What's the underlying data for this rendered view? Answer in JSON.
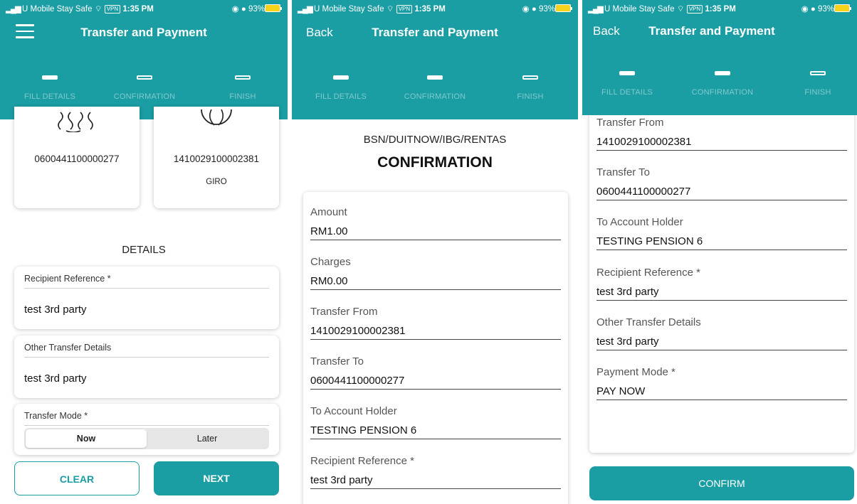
{
  "status": {
    "carrier": "U Mobile Stay Safe",
    "vpn": "VPN",
    "time": "1:35 PM",
    "battery": "93%"
  },
  "header": {
    "title": "Transfer and Payment",
    "back_label": "Back"
  },
  "steps": [
    "FILL DETAILS",
    "CONFIRMATION",
    "FINISH"
  ],
  "panel1": {
    "accounts": [
      {
        "number": "0600441100000277",
        "sub": ""
      },
      {
        "number": "1410029100002381",
        "sub": "GIRO"
      }
    ],
    "section_title": "DETAILS",
    "fields": [
      {
        "label": "Recipient Reference *",
        "value": "test 3rd party"
      },
      {
        "label": "Other Transfer Details",
        "value": "test 3rd party"
      }
    ],
    "transfer_mode": {
      "label": "Transfer Mode *",
      "options": [
        "Now",
        "Later"
      ],
      "selected": "Now"
    },
    "clear_label": "CLEAR",
    "next_label": "NEXT"
  },
  "panel2": {
    "route": "BSN/DUITNOW/IBG/RENTAS",
    "title": "CONFIRMATION",
    "rows": [
      {
        "label": "Amount",
        "value": "RM1.00"
      },
      {
        "label": "Charges",
        "value": "RM0.00"
      },
      {
        "label": "Transfer From",
        "value": "1410029100002381"
      },
      {
        "label": "Transfer To",
        "value": "0600441100000277"
      },
      {
        "label": "To Account Holder",
        "value": "TESTING PENSION 6"
      },
      {
        "label": "Recipient Reference *",
        "value": "test 3rd party"
      }
    ]
  },
  "panel3": {
    "rows": [
      {
        "label": "Transfer From",
        "value": "1410029100002381"
      },
      {
        "label": "Transfer To",
        "value": "0600441100000277"
      },
      {
        "label": "To Account Holder",
        "value": "TESTING PENSION 6"
      },
      {
        "label": "Recipient Reference *",
        "value": "test 3rd party"
      },
      {
        "label": "Other Transfer Details",
        "value": "test 3rd party"
      },
      {
        "label": "Payment Mode *",
        "value": "PAY NOW"
      }
    ],
    "confirm_label": "CONFIRM"
  },
  "colors": {
    "brand": "#1a9da3",
    "battery": "#f6d21a"
  }
}
